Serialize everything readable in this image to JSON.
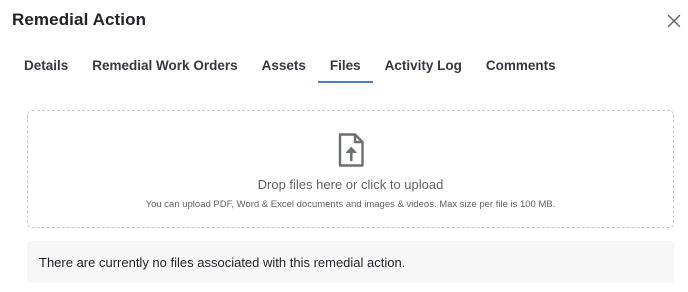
{
  "modal": {
    "title": "Remedial Action",
    "close_icon": "close-icon"
  },
  "tabs": [
    {
      "label": "Details",
      "active": false
    },
    {
      "label": "Remedial Work Orders",
      "active": false
    },
    {
      "label": "Assets",
      "active": false
    },
    {
      "label": "Files",
      "active": true
    },
    {
      "label": "Activity Log",
      "active": false
    },
    {
      "label": "Comments",
      "active": false
    }
  ],
  "upload": {
    "icon": "file-upload-icon",
    "primary_text": "Drop files here or click to upload",
    "hint_text": "You can upload PDF, Word & Excel documents and images & videos. Max size per file is 100 MB."
  },
  "empty_state": {
    "message": "There are currently no files associated with this remedial action."
  },
  "colors": {
    "active_tab_underline": "#4a7fc1",
    "dropzone_border": "#c7c9cc",
    "empty_state_background": "#f7f7f8",
    "icon_color": "#6c6f73"
  }
}
